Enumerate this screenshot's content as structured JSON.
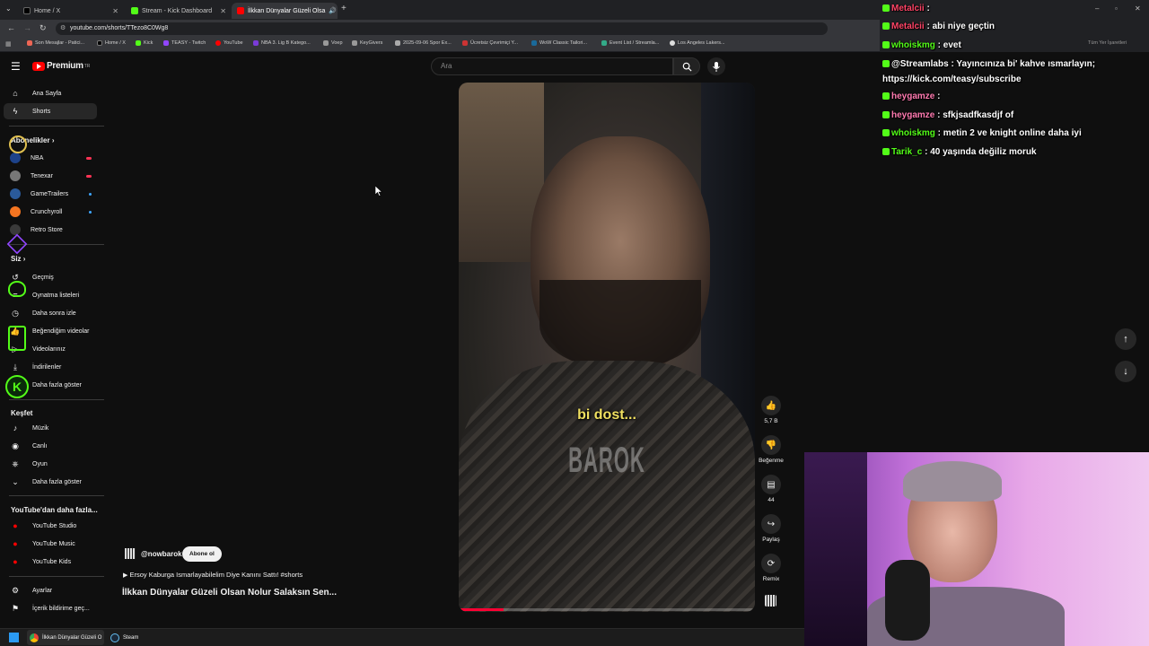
{
  "browser": {
    "tabs": [
      {
        "label": "Home / X",
        "color": "#000000"
      },
      {
        "label": "Stream - Kick Dashboard",
        "color": "#53fc18"
      },
      {
        "label": "İlkkan Dünyalar Güzeli Olsa",
        "color": "#ff0000"
      }
    ],
    "new_tab": "+",
    "url": "youtube.com/shorts/TTezo8C0Wg8",
    "bookmarks": [
      "Son Mesajlar - Patici...",
      "Home / X",
      "Kick",
      "TEASY - Twitch",
      "YouTube",
      "NBA 3. Lig B Katego...",
      "Voep",
      "KeyGivers",
      "2025-09-06 Spor Ex...",
      "Ücretsiz Çevrimiçi Y...",
      "WoW Classic Tailori...",
      "Event List / Streamla...",
      "Los Angeles Lakers..."
    ],
    "bookmark_right": "Tüm Yer İşaretleri"
  },
  "youtube": {
    "logo_text": "Premium",
    "logo_sup": "TR",
    "search_placeholder": "Ara",
    "sidebar": {
      "home": "Ana Sayfa",
      "shorts": "Shorts",
      "subscriptions_title": "Abonelikler",
      "subscriptions": [
        {
          "name": "NBA",
          "color": "#1d428a"
        },
        {
          "name": "Tenexar",
          "color": "#888888"
        },
        {
          "name": "GameTrailers",
          "color": "#2a5a9a"
        },
        {
          "name": "Crunchyroll",
          "color": "#f47521"
        },
        {
          "name": "Retro Store",
          "color": "#444444"
        }
      ],
      "you_title": "Siz",
      "you_items": [
        "Geçmiş",
        "Oynatma listeleri",
        "Daha sonra izle",
        "Beğendiğim videolar",
        "Videolarınız",
        "İndirilenler",
        "Daha fazla göster"
      ],
      "explore_title": "Keşfet",
      "explore_items": [
        "Müzik",
        "Canlı",
        "Oyun",
        "Daha fazla göster"
      ],
      "more_title": "YouTube'dan daha fazla...",
      "more_items": [
        "YouTube Studio",
        "YouTube Music",
        "YouTube Kids"
      ],
      "settings": "Ayarlar",
      "report": "İçerik bildirime geç..."
    },
    "short": {
      "caption": "bi dost...",
      "watermark": "BAROK",
      "channel": "@nowbarok",
      "subscribe": "Abone ol",
      "sound": "Ersoy Kaburga Ismarlayabilelim Diye Kanını Sattı! #shorts",
      "title": "İlkkan Dünyalar Güzeli Olsan Nolur Salaksın Sen...",
      "progress": 0.15
    },
    "actions": {
      "like_count": "5,7 B",
      "dislike": "Beğenme",
      "comments": "44",
      "share": "Paylaş",
      "remix": "Remix"
    }
  },
  "chat": [
    {
      "user": "Metalcii",
      "sep": " : ",
      "msg": "",
      "color": "#ff4466"
    },
    {
      "user": "Metalcii",
      "sep": " : ",
      "msg": "abi niye geçtin",
      "color": "#ff4466"
    },
    {
      "user": "whoiskmg",
      "sep": " : ",
      "msg": "evet",
      "color": "#53fc18"
    },
    {
      "user": "@Streamlabs",
      "sep": " : ",
      "msg": "Yayıncınıza bi' kahve ısmarlayın;",
      "color": "#ffffff"
    },
    {
      "user": "",
      "sep": "",
      "msg": "https://kick.com/teasy/subscribe",
      "color": "#ffffff"
    },
    {
      "user": "heygamze",
      "sep": " : ",
      "msg": "",
      "color": "#ff7ab0"
    },
    {
      "user": "heygamze",
      "sep": " : ",
      "msg": "sfkjsadfkasdjf of",
      "color": "#ff7ab0"
    },
    {
      "user": "whoiskmg",
      "sep": " : ",
      "msg": "metin 2 ve knight online daha iyi",
      "color": "#53fc18"
    },
    {
      "user": "Tarik_c",
      "sep": " : ",
      "msg": "40 yaşında değiliz moruk",
      "color": "#53fc18"
    }
  ],
  "taskbar": {
    "items": [
      "İlkkan Dünyalar Güzeli O",
      "Steam"
    ]
  }
}
